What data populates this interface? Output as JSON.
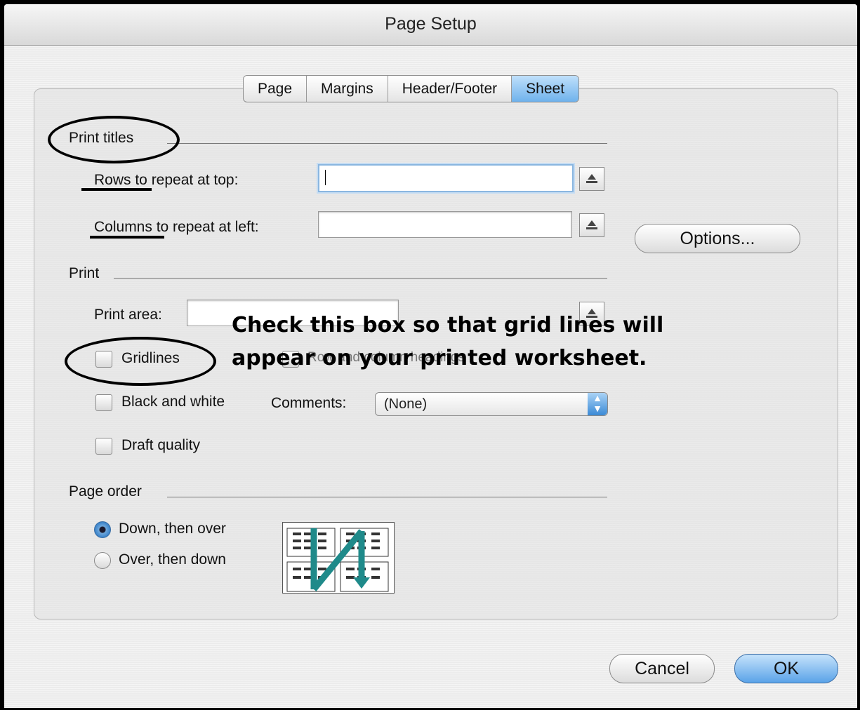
{
  "window": {
    "title": "Page Setup"
  },
  "tabs": [
    {
      "label": "Page",
      "selected": false
    },
    {
      "label": "Margins",
      "selected": false
    },
    {
      "label": "Header/Footer",
      "selected": false
    },
    {
      "label": "Sheet",
      "selected": true
    }
  ],
  "print_titles": {
    "group_label": "Print titles",
    "rows_label": "Rows to repeat at top:",
    "rows_value": "",
    "columns_label": "Columns to repeat at left:",
    "columns_value": ""
  },
  "options_button": "Options...",
  "print": {
    "group_label": "Print",
    "print_area_label": "Print area:",
    "print_area_value": "",
    "gridlines_label": "Gridlines",
    "gridlines_checked": false,
    "row_col_headings_label": "Row and column headings",
    "black_white_label": "Black and white",
    "comments_label": "Comments:",
    "comments_value": "(None)",
    "draft_label": "Draft quality"
  },
  "page_order": {
    "group_label": "Page order",
    "options": [
      {
        "label": "Down, then over",
        "selected": true
      },
      {
        "label": "Over, then down",
        "selected": false
      }
    ]
  },
  "buttons": {
    "cancel": "Cancel",
    "ok": "OK"
  },
  "annotation": {
    "line1": "Check this box so that grid lines will",
    "line2": "appear on your printed worksheet."
  },
  "colors": {
    "accent": "#5aa3e8",
    "annotation": "#000000",
    "preview_arrow": "#1f8a8a"
  }
}
